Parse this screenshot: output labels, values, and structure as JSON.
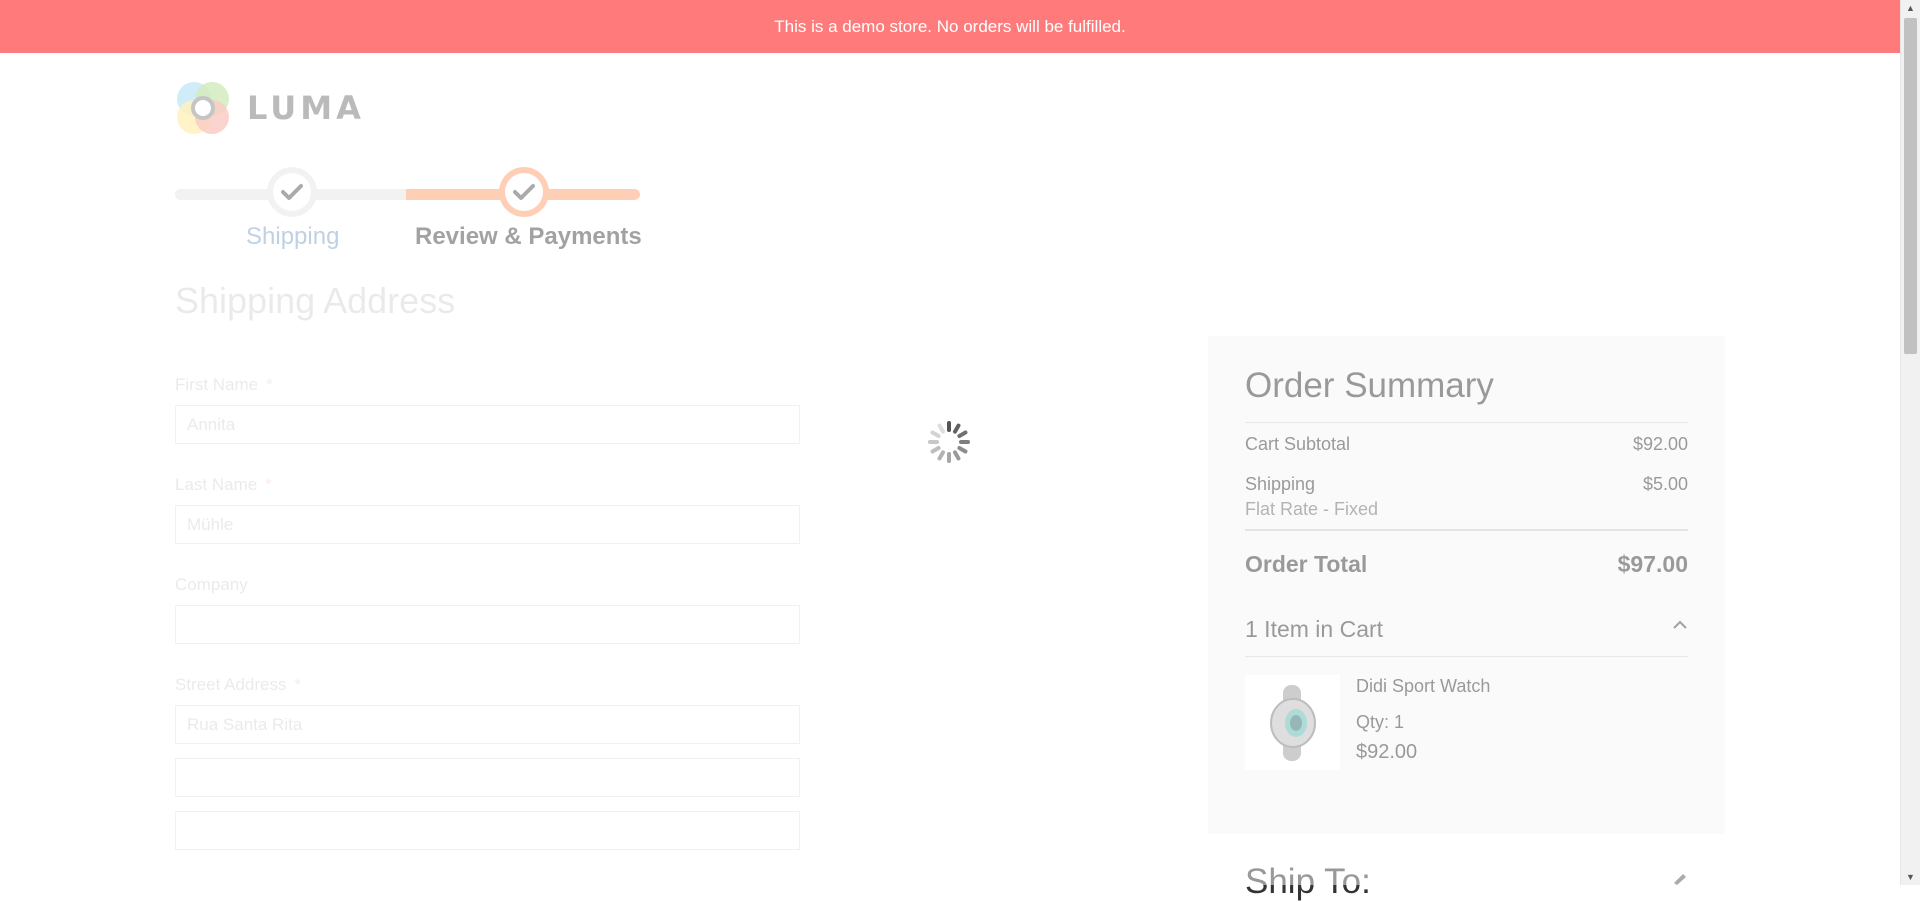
{
  "banner": {
    "text": "This is a demo store. No orders will be fulfilled."
  },
  "logo": {
    "text": "LUMA"
  },
  "progress": {
    "steps": [
      {
        "label": "Shipping",
        "completed": true
      },
      {
        "label": "Review & Payments",
        "completed": true,
        "active": true
      }
    ]
  },
  "shipping_form": {
    "title": "Shipping Address",
    "required_marker": "*",
    "first_name": {
      "label": "First Name",
      "value": "Annita"
    },
    "last_name": {
      "label": "Last Name",
      "value": "Mühle"
    },
    "company": {
      "label": "Company",
      "value": ""
    },
    "street": {
      "label": "Street Address",
      "line1": "Rua Santa Rita",
      "line2": "",
      "line3": ""
    }
  },
  "summary": {
    "title": "Order Summary",
    "subtotal_label": "Cart Subtotal",
    "subtotal_value": "$92.00",
    "shipping_label": "Shipping",
    "shipping_value": "$5.00",
    "shipping_method": "Flat Rate - Fixed",
    "total_label": "Order Total",
    "total_value": "$97.00",
    "items_header": "1 Item in Cart",
    "item": {
      "name": "Didi Sport Watch",
      "qty": "Qty: 1",
      "price": "$92.00"
    },
    "ship_to_title": "Ship To:"
  },
  "colors": {
    "banner": "#ff7b7b",
    "accent": "#ff9e6b",
    "link": "#7fa2c4",
    "summary_bg": "#f5f5f5"
  }
}
